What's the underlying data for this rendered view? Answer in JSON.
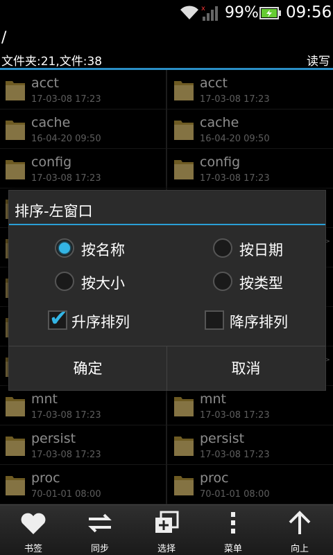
{
  "status": {
    "battery_pct": "99%",
    "time": "09:56"
  },
  "header": {
    "path": "/",
    "info": "文件夹:21,文件:38",
    "mode": "读写"
  },
  "left_files": [
    {
      "name": "acct",
      "date": "17-03-08 17:23"
    },
    {
      "name": "cache",
      "date": "16-04-20 09:50"
    },
    {
      "name": "config",
      "date": "17-03-08 17:23"
    },
    {
      "name": "mnt",
      "date": "17-03-08 17:23"
    },
    {
      "name": "persist",
      "date": "17-03-08 17:23"
    },
    {
      "name": "proc",
      "date": "70-01-01 08:00"
    }
  ],
  "right_files": [
    {
      "name": "acct",
      "date": "17-03-08 17:23"
    },
    {
      "name": "cache",
      "date": "16-04-20 09:50"
    },
    {
      "name": "config",
      "date": "17-03-08 17:23"
    },
    {
      "name": "mnt",
      "date": "17-03-08 17:23"
    },
    {
      "name": "persist",
      "date": "17-03-08 17:23"
    },
    {
      "name": "proc",
      "date": "70-01-01 08:00"
    }
  ],
  "dialog": {
    "title": "排序-左窗口",
    "options": {
      "by_name": "按名称",
      "by_date": "按日期",
      "by_size": "按大小",
      "by_type": "按类型"
    },
    "selected": "by_name",
    "ascending": "升序排列",
    "descending": "降序排列",
    "ascending_checked": true,
    "descending_checked": false,
    "ok": "确定",
    "cancel": "取消"
  },
  "bottom": {
    "bookmark": "书签",
    "sync": "同步",
    "select": "选择",
    "menu": "菜单",
    "up": "向上"
  },
  "colors": {
    "accent": "#33b5e5",
    "folder": "#e8c860"
  }
}
